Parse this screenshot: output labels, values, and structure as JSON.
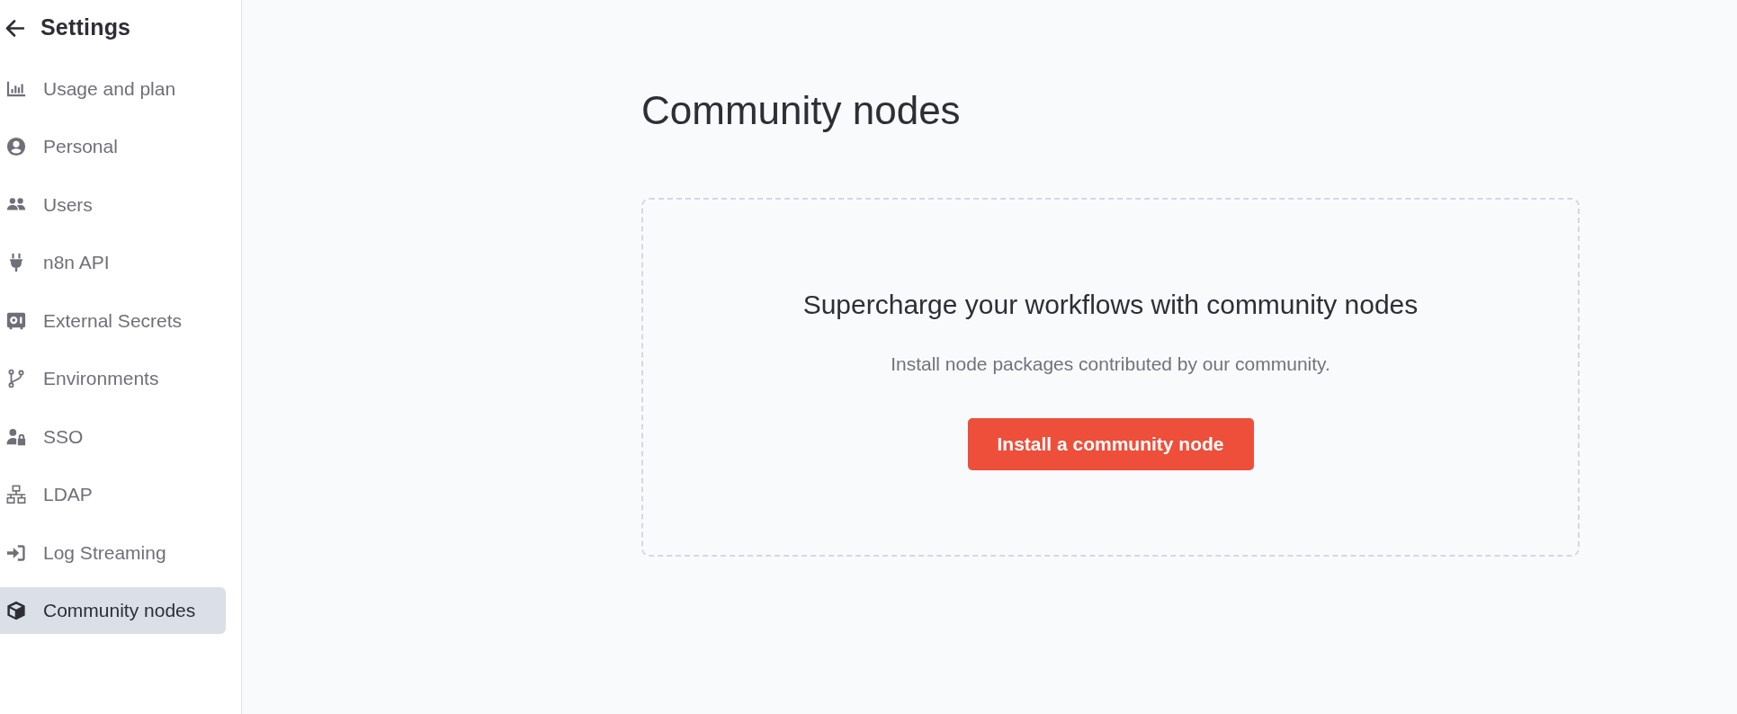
{
  "sidebar": {
    "title": "Settings",
    "items": [
      {
        "label": "Usage and plan",
        "selected": false
      },
      {
        "label": "Personal",
        "selected": false
      },
      {
        "label": "Users",
        "selected": false
      },
      {
        "label": "n8n API",
        "selected": false
      },
      {
        "label": "External Secrets",
        "selected": false
      },
      {
        "label": "Environments",
        "selected": false
      },
      {
        "label": "SSO",
        "selected": false
      },
      {
        "label": "LDAP",
        "selected": false
      },
      {
        "label": "Log Streaming",
        "selected": false
      },
      {
        "label": "Community nodes",
        "selected": true
      }
    ]
  },
  "page": {
    "title": "Community nodes"
  },
  "empty_state": {
    "heading": "Supercharge your workflows with community nodes",
    "description": "Install node packages contributed by our community.",
    "button": "Install a community node"
  }
}
